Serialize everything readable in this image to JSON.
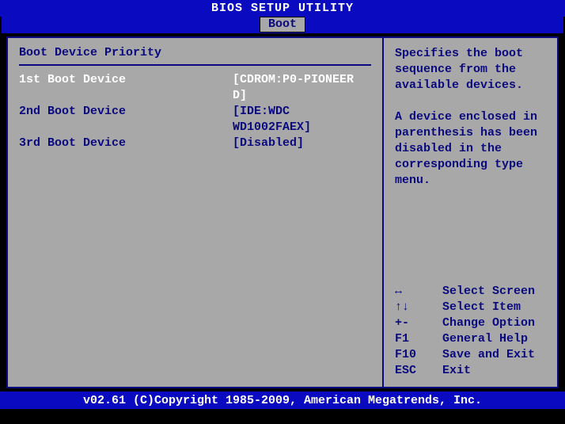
{
  "header": {
    "title": "BIOS SETUP UTILITY"
  },
  "tabs": {
    "active": "Boot"
  },
  "section": {
    "title": "Boot Device Priority"
  },
  "boot_devices": [
    {
      "label": "1st Boot Device",
      "value": "[CDROM:P0-PIONEER D]",
      "selected": true
    },
    {
      "label": "2nd Boot Device",
      "value": "[IDE:WDC WD1002FAEX]",
      "selected": false
    },
    {
      "label": "3rd Boot Device",
      "value": "[Disabled]",
      "selected": false
    }
  ],
  "help": {
    "p1": "Specifies the boot sequence from the available devices.",
    "p2": "A device enclosed in parenthesis has been disabled in the corresponding type menu."
  },
  "hints": [
    {
      "key": "↔",
      "action": "Select Screen"
    },
    {
      "key": "↑↓",
      "action": "Select Item"
    },
    {
      "key": "+-",
      "action": "Change Option"
    },
    {
      "key": "F1",
      "action": "General Help"
    },
    {
      "key": "F10",
      "action": "Save and Exit"
    },
    {
      "key": "ESC",
      "action": "Exit"
    }
  ],
  "footer": {
    "text": "v02.61 (C)Copyright 1985-2009, American Megatrends, Inc."
  }
}
